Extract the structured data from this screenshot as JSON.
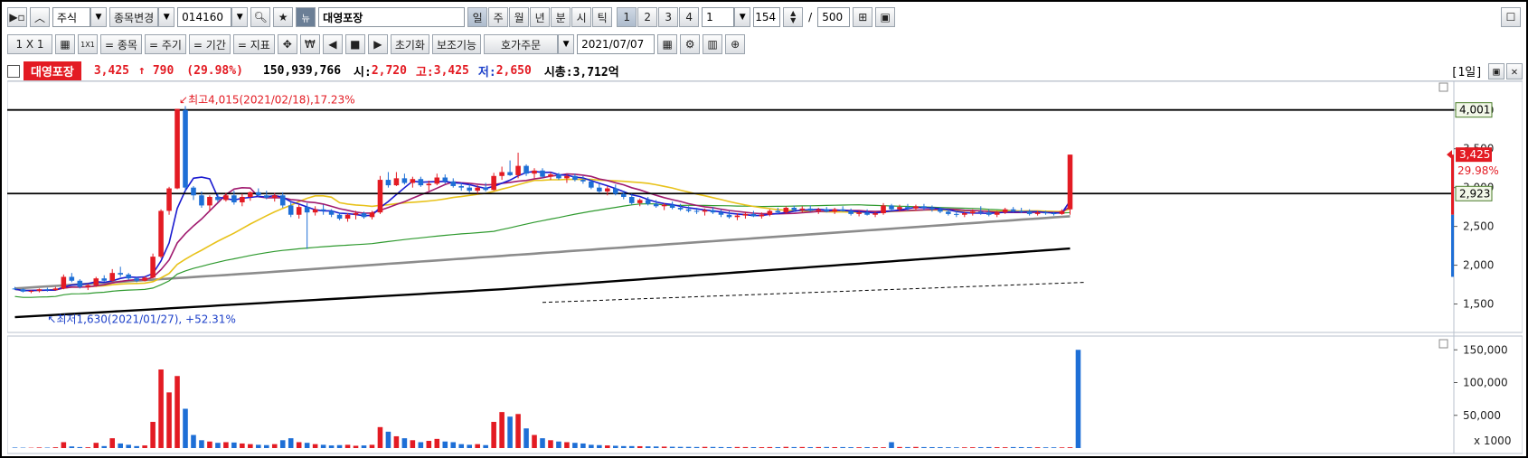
{
  "toolbar1": {
    "market": "주식",
    "change_stock_label": "종목변경",
    "code": "014160",
    "news_label": "뉴",
    "stock_name": "대영포장",
    "periods": [
      "일",
      "주",
      "월",
      "년",
      "분",
      "시",
      "틱"
    ],
    "active_period": "일",
    "counts": [
      "1",
      "2",
      "3",
      "4"
    ],
    "interval_value": "1",
    "bar_count": "154",
    "separator": "/",
    "max_bars": "500"
  },
  "toolbar2": {
    "layout_label": "1 X 1",
    "single_label": "1X1",
    "item_label": "= 종목",
    "cycle_label": "= 주기",
    "period_label": "= 기간",
    "indicator_label": "= 지표",
    "won_label": "₩",
    "reset_label": "초기화",
    "aux_label": "보조기능",
    "order_label": "호가주문",
    "date_value": "2021/07/07"
  },
  "info": {
    "name": "대영포장",
    "price": "3,425",
    "arrow": "↑",
    "change": "790",
    "change_pct": "(29.98%)",
    "volume": "150,939,766",
    "open_label": "시:",
    "open": "2,720",
    "high_label": "고:",
    "high": "3,425",
    "low_label": "저:",
    "low": "2,650",
    "cap_label": "시총:",
    "cap": "3,712억",
    "period_badge": "[1일]"
  },
  "chart_data": [
    {
      "type": "candlestick",
      "ylim": [
        1250,
        4300
      ],
      "y_ticks": [
        "1,500",
        "2,000",
        "2,500",
        "3,000",
        "3,500",
        "4,000"
      ],
      "y_tick_values": [
        1500,
        2000,
        2500,
        3000,
        3500,
        4000
      ],
      "hlines": [
        {
          "label": "4,001",
          "value": 4001
        },
        {
          "label": "2,923",
          "value": 2923
        }
      ],
      "last_price_label": "3,425",
      "last_price_pct": "29.98%",
      "annotation_high": "↙최고4,015(2021/02/18),17.23%",
      "annotation_low": "↖최저1,630(2021/01/27), +52.31%",
      "colors": {
        "up": "#e31b23",
        "down": "#1e6fd6",
        "ma5": "#1b1bd0",
        "ma10": "#a01a6f",
        "ma20": "#e8c21a",
        "ma60": "#2f9a2f",
        "ma120": "#8c8c8c",
        "ma240": "#000000"
      },
      "candles": [
        [
          1700,
          1720,
          1680,
          1690
        ],
        [
          1690,
          1700,
          1650,
          1660
        ],
        [
          1660,
          1680,
          1640,
          1670
        ],
        [
          1670,
          1700,
          1650,
          1690
        ],
        [
          1690,
          1710,
          1660,
          1680
        ],
        [
          1680,
          1720,
          1670,
          1700
        ],
        [
          1700,
          1880,
          1690,
          1850
        ],
        [
          1850,
          1900,
          1780,
          1800
        ],
        [
          1800,
          1820,
          1700,
          1720
        ],
        [
          1720,
          1760,
          1680,
          1740
        ],
        [
          1740,
          1850,
          1720,
          1830
        ],
        [
          1830,
          1870,
          1790,
          1800
        ],
        [
          1800,
          1950,
          1790,
          1900
        ],
        [
          1900,
          1980,
          1850,
          1880
        ],
        [
          1880,
          1900,
          1810,
          1830
        ],
        [
          1830,
          1850,
          1780,
          1800
        ],
        [
          1800,
          1860,
          1790,
          1840
        ],
        [
          1840,
          2150,
          1830,
          2110
        ],
        [
          2110,
          2720,
          2090,
          2700
        ],
        [
          2700,
          3010,
          2650,
          2990
        ],
        [
          2990,
          4015,
          2980,
          4015
        ],
        [
          4000,
          4050,
          2960,
          3000
        ],
        [
          3000,
          3020,
          2840,
          2900
        ],
        [
          2900,
          2950,
          2740,
          2770
        ],
        [
          2770,
          2900,
          2700,
          2880
        ],
        [
          2880,
          2920,
          2810,
          2840
        ],
        [
          2840,
          2930,
          2820,
          2900
        ],
        [
          2900,
          2960,
          2780,
          2810
        ],
        [
          2810,
          2920,
          2760,
          2880
        ],
        [
          2880,
          2950,
          2830,
          2940
        ],
        [
          2940,
          2990,
          2880,
          2900
        ],
        [
          2900,
          2960,
          2850,
          2870
        ],
        [
          2870,
          2930,
          2820,
          2900
        ],
        [
          2900,
          2940,
          2740,
          2770
        ],
        [
          2770,
          2820,
          2620,
          2650
        ],
        [
          2650,
          2780,
          2600,
          2750
        ],
        [
          2750,
          2800,
          2210,
          2680
        ],
        [
          2680,
          2760,
          2640,
          2720
        ],
        [
          2720,
          2780,
          2650,
          2700
        ],
        [
          2700,
          2720,
          2620,
          2650
        ],
        [
          2650,
          2680,
          2580,
          2600
        ],
        [
          2600,
          2670,
          2560,
          2650
        ],
        [
          2650,
          2700,
          2590,
          2670
        ],
        [
          2670,
          2690,
          2600,
          2620
        ],
        [
          2620,
          2700,
          2590,
          2680
        ],
        [
          2680,
          3150,
          2660,
          3100
        ],
        [
          3100,
          3200,
          3000,
          3030
        ],
        [
          3030,
          3200,
          3020,
          3120
        ],
        [
          3120,
          3180,
          3040,
          3060
        ],
        [
          3060,
          3140,
          3000,
          3110
        ],
        [
          3110,
          3140,
          3010,
          3030
        ],
        [
          3030,
          3090,
          2960,
          3050
        ],
        [
          3050,
          3180,
          3030,
          3130
        ],
        [
          3130,
          3170,
          3050,
          3080
        ],
        [
          3080,
          3120,
          3000,
          3020
        ],
        [
          3020,
          3060,
          2960,
          3000
        ],
        [
          3000,
          3050,
          2930,
          2960
        ],
        [
          2960,
          3030,
          2920,
          3000
        ],
        [
          3000,
          3060,
          2950,
          2970
        ],
        [
          2970,
          3190,
          2960,
          3150
        ],
        [
          3150,
          3270,
          3100,
          3200
        ],
        [
          3200,
          3350,
          3150,
          3160
        ],
        [
          3160,
          3450,
          3120,
          3280
        ],
        [
          3280,
          3300,
          3150,
          3180
        ],
        [
          3180,
          3250,
          3120,
          3220
        ],
        [
          3220,
          3250,
          3120,
          3140
        ],
        [
          3140,
          3200,
          3100,
          3170
        ],
        [
          3170,
          3190,
          3100,
          3120
        ],
        [
          3120,
          3170,
          3060,
          3150
        ],
        [
          3150,
          3180,
          3080,
          3100
        ],
        [
          3100,
          3150,
          3050,
          3080
        ],
        [
          3080,
          3100,
          2980,
          3000
        ],
        [
          3000,
          3050,
          2930,
          2950
        ],
        [
          2950,
          3020,
          2900,
          2990
        ],
        [
          2990,
          3040,
          2900,
          2920
        ],
        [
          2920,
          2960,
          2850,
          2880
        ],
        [
          2880,
          2920,
          2780,
          2800
        ],
        [
          2800,
          2860,
          2760,
          2840
        ],
        [
          2840,
          2880,
          2770,
          2790
        ],
        [
          2790,
          2840,
          2740,
          2760
        ],
        [
          2760,
          2800,
          2710,
          2780
        ],
        [
          2780,
          2820,
          2720,
          2740
        ],
        [
          2740,
          2790,
          2700,
          2720
        ],
        [
          2720,
          2760,
          2680,
          2700
        ],
        [
          2700,
          2740,
          2660,
          2690
        ],
        [
          2690,
          2730,
          2640,
          2710
        ],
        [
          2710,
          2750,
          2660,
          2680
        ],
        [
          2680,
          2720,
          2620,
          2650
        ],
        [
          2650,
          2700,
          2600,
          2620
        ],
        [
          2620,
          2670,
          2580,
          2640
        ],
        [
          2640,
          2690,
          2600,
          2660
        ],
        [
          2660,
          2700,
          2620,
          2630
        ],
        [
          2630,
          2680,
          2600,
          2650
        ],
        [
          2650,
          2720,
          2630,
          2700
        ],
        [
          2700,
          2740,
          2660,
          2680
        ],
        [
          2680,
          2760,
          2660,
          2740
        ],
        [
          2740,
          2770,
          2690,
          2710
        ],
        [
          2710,
          2760,
          2680,
          2730
        ],
        [
          2730,
          2770,
          2690,
          2700
        ],
        [
          2700,
          2740,
          2660,
          2720
        ],
        [
          2720,
          2750,
          2680,
          2690
        ],
        [
          2690,
          2740,
          2660,
          2720
        ],
        [
          2720,
          2760,
          2690,
          2700
        ],
        [
          2700,
          2730,
          2640,
          2660
        ],
        [
          2660,
          2700,
          2630,
          2680
        ],
        [
          2680,
          2720,
          2640,
          2650
        ],
        [
          2650,
          2690,
          2620,
          2670
        ],
        [
          2670,
          2800,
          2650,
          2770
        ],
        [
          2770,
          2790,
          2700,
          2720
        ],
        [
          2720,
          2780,
          2690,
          2750
        ],
        [
          2750,
          2790,
          2700,
          2730
        ],
        [
          2730,
          2780,
          2700,
          2760
        ],
        [
          2760,
          2790,
          2710,
          2740
        ],
        [
          2740,
          2770,
          2690,
          2720
        ],
        [
          2720,
          2750,
          2670,
          2690
        ],
        [
          2690,
          2720,
          2640,
          2660
        ],
        [
          2660,
          2700,
          2620,
          2650
        ],
        [
          2650,
          2690,
          2620,
          2670
        ],
        [
          2670,
          2720,
          2640,
          2690
        ],
        [
          2690,
          2760,
          2650,
          2680
        ],
        [
          2680,
          2720,
          2630,
          2650
        ],
        [
          2650,
          2700,
          2620,
          2680
        ],
        [
          2680,
          2740,
          2660,
          2720
        ],
        [
          2720,
          2750,
          2680,
          2700
        ],
        [
          2700,
          2740,
          2670,
          2690
        ],
        [
          2690,
          2720,
          2640,
          2660
        ],
        [
          2660,
          2700,
          2640,
          2680
        ],
        [
          2680,
          2700,
          2650,
          2670
        ],
        [
          2670,
          2690,
          2640,
          2660
        ],
        [
          2660,
          2720,
          2650,
          2700
        ],
        [
          2720,
          3425,
          2650,
          3425
        ]
      ]
    },
    {
      "type": "bar",
      "title": "volume",
      "ylim": [
        0,
        160000
      ],
      "y_ticks": [
        "50,000",
        "100,000",
        "150,000"
      ],
      "y_tick_values": [
        50000,
        100000,
        150000
      ],
      "unit": "x 1000",
      "values": [
        800,
        600,
        500,
        900,
        700,
        1200,
        9000,
        2500,
        1500,
        1200,
        8000,
        3000,
        15000,
        7000,
        5000,
        3000,
        4000,
        40000,
        120000,
        85000,
        110000,
        60000,
        20000,
        12000,
        10000,
        8000,
        9000,
        8500,
        7000,
        6000,
        5000,
        4500,
        6000,
        12000,
        15000,
        9000,
        8000,
        6000,
        5000,
        4000,
        4500,
        5000,
        3500,
        4000,
        5000,
        32000,
        25000,
        18000,
        15000,
        12000,
        9000,
        11000,
        14000,
        10000,
        9000,
        6000,
        5000,
        6000,
        4500,
        40000,
        55000,
        48000,
        52000,
        30000,
        20000,
        15000,
        12000,
        10000,
        9000,
        8000,
        7000,
        5000,
        4500,
        4000,
        3500,
        3000,
        3000,
        2800,
        2600,
        2400,
        2200,
        2000,
        1800,
        1800,
        1600,
        1800,
        1700,
        1500,
        1400,
        1600,
        1500,
        1400,
        1300,
        1500,
        1400,
        1800,
        1500,
        1600,
        1400,
        1500,
        1600,
        1400,
        1500,
        1300,
        1200,
        1400,
        1300,
        1200,
        9000,
        1600,
        1500,
        1700,
        1500,
        1400,
        1300,
        1200,
        1100,
        1100,
        1200,
        1300,
        1500,
        1300,
        1200,
        1500,
        1400,
        1300,
        1200,
        1100,
        1100,
        1000,
        1200,
        150000
      ]
    }
  ]
}
